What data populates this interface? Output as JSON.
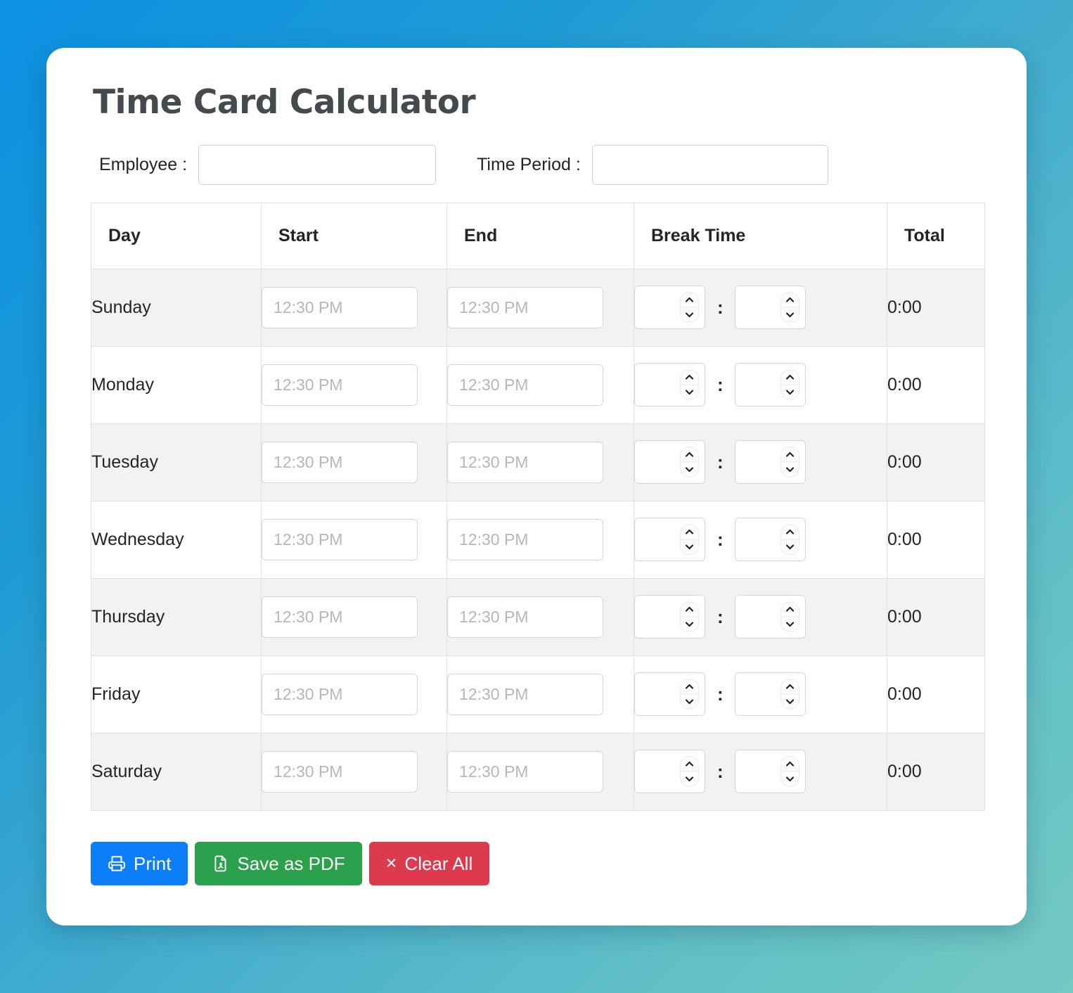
{
  "app": {
    "title": "Time Card Calculator",
    "accent_blue": "#0d7ef9",
    "accent_green": "#2ba14c",
    "accent_red": "#dd3a4d",
    "background_from": "#0b90e3",
    "background_to": "#74c9c3"
  },
  "meta": {
    "employee_label": "Employee :",
    "employee_value": "",
    "employee_placeholder": "",
    "period_label": "Time Period :",
    "period_value": "",
    "period_placeholder": ""
  },
  "table": {
    "headers": {
      "day": "Day",
      "start": "Start",
      "end": "End",
      "break": "Break Time",
      "total": "Total"
    },
    "time_placeholder": "12:30 PM",
    "break_separator": ":",
    "rows": [
      {
        "day": "Sunday",
        "start": "",
        "end": "",
        "break_hours": "",
        "break_minutes": "",
        "total": "0:00"
      },
      {
        "day": "Monday",
        "start": "",
        "end": "",
        "break_hours": "",
        "break_minutes": "",
        "total": "0:00"
      },
      {
        "day": "Tuesday",
        "start": "",
        "end": "",
        "break_hours": "",
        "break_minutes": "",
        "total": "0:00"
      },
      {
        "day": "Wednesday",
        "start": "",
        "end": "",
        "break_hours": "",
        "break_minutes": "",
        "total": "0:00"
      },
      {
        "day": "Thursday",
        "start": "",
        "end": "",
        "break_hours": "",
        "break_minutes": "",
        "total": "0:00"
      },
      {
        "day": "Friday",
        "start": "",
        "end": "",
        "break_hours": "",
        "break_minutes": "",
        "total": "0:00"
      },
      {
        "day": "Saturday",
        "start": "",
        "end": "",
        "break_hours": "",
        "break_minutes": "",
        "total": "0:00"
      }
    ]
  },
  "actions": {
    "print": {
      "label": "Print",
      "icon": "printer-icon"
    },
    "save_pdf": {
      "label": "Save as PDF",
      "icon": "file-pdf-icon"
    },
    "clear_all": {
      "label": "Clear All",
      "icon": "close-x-icon",
      "glyph": "×"
    }
  }
}
